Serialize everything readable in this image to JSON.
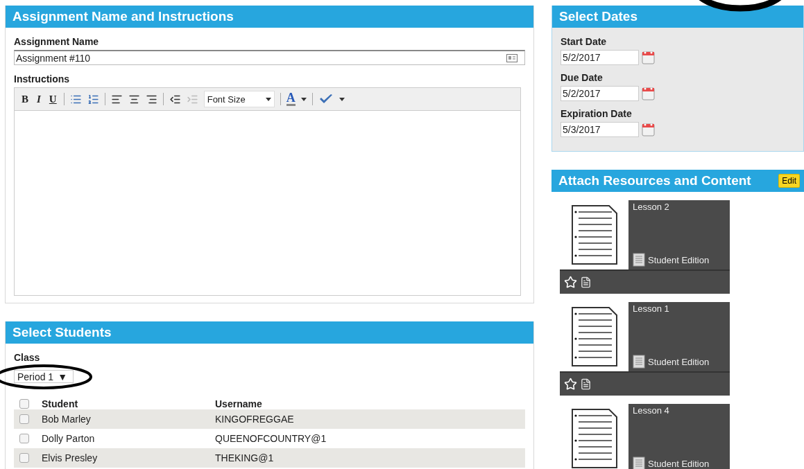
{
  "assignment_panel": {
    "title": "Assignment Name and Instructions",
    "name_label": "Assignment Name",
    "name_value": "Assignment #110",
    "instructions_label": "Instructions",
    "toolbar": {
      "format_buttons": [
        "B",
        "I",
        "U"
      ],
      "font_size": "Font Size",
      "font_color": "A"
    }
  },
  "students_panel": {
    "title": "Select Students",
    "class_label": "Class",
    "class_value": "Period 1",
    "dropdown_arrow": "▼",
    "columns": [
      "Student",
      "Username"
    ],
    "header_checked": false,
    "rows": [
      {
        "student": "Bob Marley",
        "username": "KINGOFREGGAE",
        "checked": false
      },
      {
        "student": "Dolly Parton",
        "username": "QUEENOFCOUNTRY@1",
        "checked": false
      },
      {
        "student": "Elvis Presley",
        "username": "THEKING@1",
        "checked": false
      }
    ]
  },
  "dates_panel": {
    "title": "Select Dates",
    "fields": [
      {
        "label": "Start Date",
        "value": "5/2/2017"
      },
      {
        "label": "Due Date",
        "value": "5/2/2017"
      },
      {
        "label": "Expiration Date",
        "value": "5/3/2017"
      }
    ]
  },
  "resources_panel": {
    "title": "Attach Resources and Content",
    "edit_button": "Edit",
    "items": [
      {
        "title": "Lesson 2",
        "edition": "Student Edition",
        "actions_visible": true
      },
      {
        "title": "Lesson 1",
        "edition": "Student Edition",
        "actions_visible": true
      },
      {
        "title": "Lesson 4",
        "edition": "Student Edition"
      }
    ]
  }
}
